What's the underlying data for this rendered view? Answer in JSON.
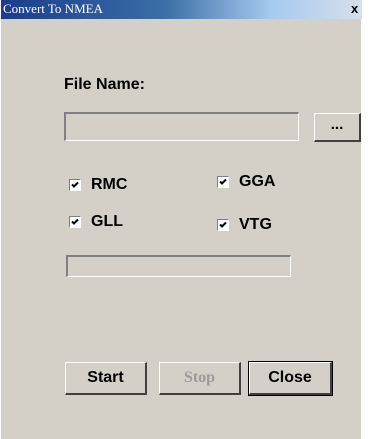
{
  "window": {
    "title": "Convert To NMEA",
    "close_glyph": "x"
  },
  "form": {
    "file_name_label": "File Name:",
    "file_name_value": "",
    "browse_label": "...",
    "checkboxes": [
      {
        "label": "RMC",
        "checked": true
      },
      {
        "label": "GGA",
        "checked": true
      },
      {
        "label": "GLL",
        "checked": true
      },
      {
        "label": "VTG",
        "checked": true
      }
    ],
    "progress": 0
  },
  "buttons": {
    "start_label": "Start",
    "stop_label": "Stop",
    "stop_enabled": false,
    "close_label": "Close"
  },
  "colors": {
    "dialog_face": "#d4d0c8",
    "title_gradient_start": "#1b3c8c",
    "disabled_text": "#9a9a9a"
  }
}
